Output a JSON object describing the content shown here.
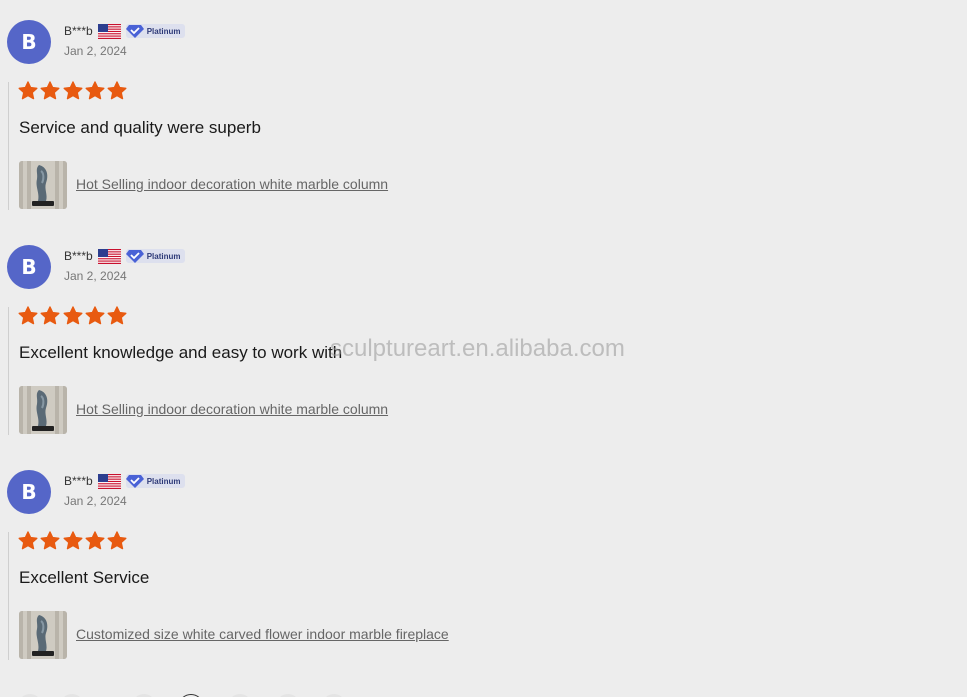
{
  "reviews": [
    {
      "avatar_letter": "B",
      "user_name": "B***b",
      "badge": "Platinum",
      "date": "Jan 2, 2024",
      "rating": 5,
      "comment": "Service and quality were superb",
      "product_link": "Hot Selling indoor decoration white marble column"
    },
    {
      "avatar_letter": "B",
      "user_name": "B***b",
      "badge": "Platinum",
      "date": "Jan 2, 2024",
      "rating": 5,
      "comment": "Excellent knowledge and easy to work with",
      "product_link": "Hot Selling indoor decoration white marble column"
    },
    {
      "avatar_letter": "B",
      "user_name": "B***b",
      "badge": "Platinum",
      "date": "Jan 2, 2024",
      "rating": 5,
      "comment": "Excellent Service",
      "product_link": "Customized size white carved flower indoor marble fireplace"
    }
  ],
  "watermark": "sculptureart.en.alibaba.com",
  "colors": {
    "avatar": "#5566c8",
    "star": "#e85a10",
    "badge_bg": "#dde0ee",
    "badge_icon": "#4a62d6",
    "page_bg": "#ededed"
  },
  "icons": {
    "flag": "us-flag-icon",
    "badge": "verified-diamond-icon",
    "star": "star-icon"
  }
}
